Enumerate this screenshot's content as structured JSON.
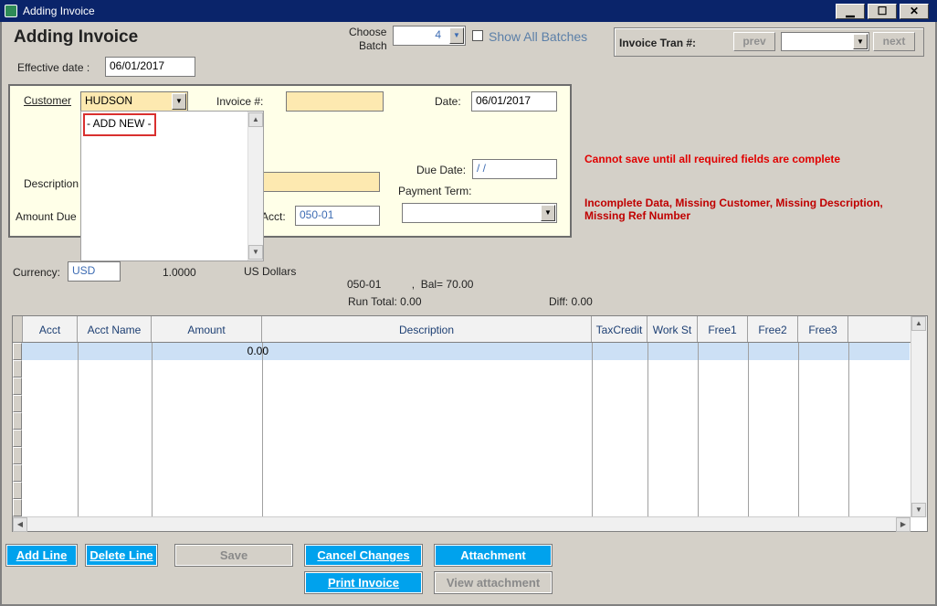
{
  "window": {
    "title": "Adding Invoice",
    "min": "▁",
    "max": "☐",
    "close": "✕"
  },
  "header": {
    "title": "Adding Invoice",
    "effective_date_label": "Effective date :",
    "effective_date": "06/01/2017",
    "choose_batch_label_1": "Choose",
    "choose_batch_label_2": "Batch",
    "batch_value": "4",
    "show_all_batches": "Show All Batches",
    "invoice_tran_label": "Invoice Tran #:",
    "prev": "prev",
    "next": "next"
  },
  "form": {
    "customer_label": "Customer",
    "customer_value": "HUDSON",
    "invoice_label": "Invoice #:",
    "invoice_value": "",
    "date_label": "Date:",
    "date_value": "06/01/2017",
    "description_label": "Description",
    "due_date_label": "Due Date:",
    "due_date_value": " /  /",
    "payment_term_label": "Payment Term:",
    "payment_term_value": "",
    "amount_due_label": "Amount Due",
    "acct_label": "Acct:",
    "acct_value": "050-01"
  },
  "dropdown": {
    "items": [
      "- ADD NEW -"
    ]
  },
  "errors": {
    "main": "Cannot save until all required fields are complete",
    "detail_1": "Incomplete Data, Missing Customer, Missing Description,",
    "detail_2": "Missing Ref Number"
  },
  "currency": {
    "label": "Currency:",
    "code": "USD",
    "rate": "1.0000",
    "name": "US Dollars"
  },
  "summary": {
    "acct_balance": "050-01          ,  Bal= 70.00",
    "run_total": "Run Total:  0.00",
    "diff": "Diff:  0.00"
  },
  "grid": {
    "columns": [
      "Acct",
      "Acct Name",
      "Amount",
      "Description",
      "TaxCredit",
      "Work St",
      "Free1",
      "Free2",
      "Free3"
    ],
    "rows": [
      {
        "amount": "0.00"
      }
    ]
  },
  "buttons": {
    "add_line": "Add Line",
    "delete_line": "Delete Line",
    "save": "Save",
    "cancel_changes": "Cancel Changes",
    "attachment": "Attachment",
    "print_invoice": "Print Invoice",
    "view_attachment": "View attachment"
  },
  "colors": {
    "titlebar": "#0a246a",
    "accent_button": "#00a2ed",
    "error": "#e00000",
    "required_field": "#fde9b0"
  }
}
